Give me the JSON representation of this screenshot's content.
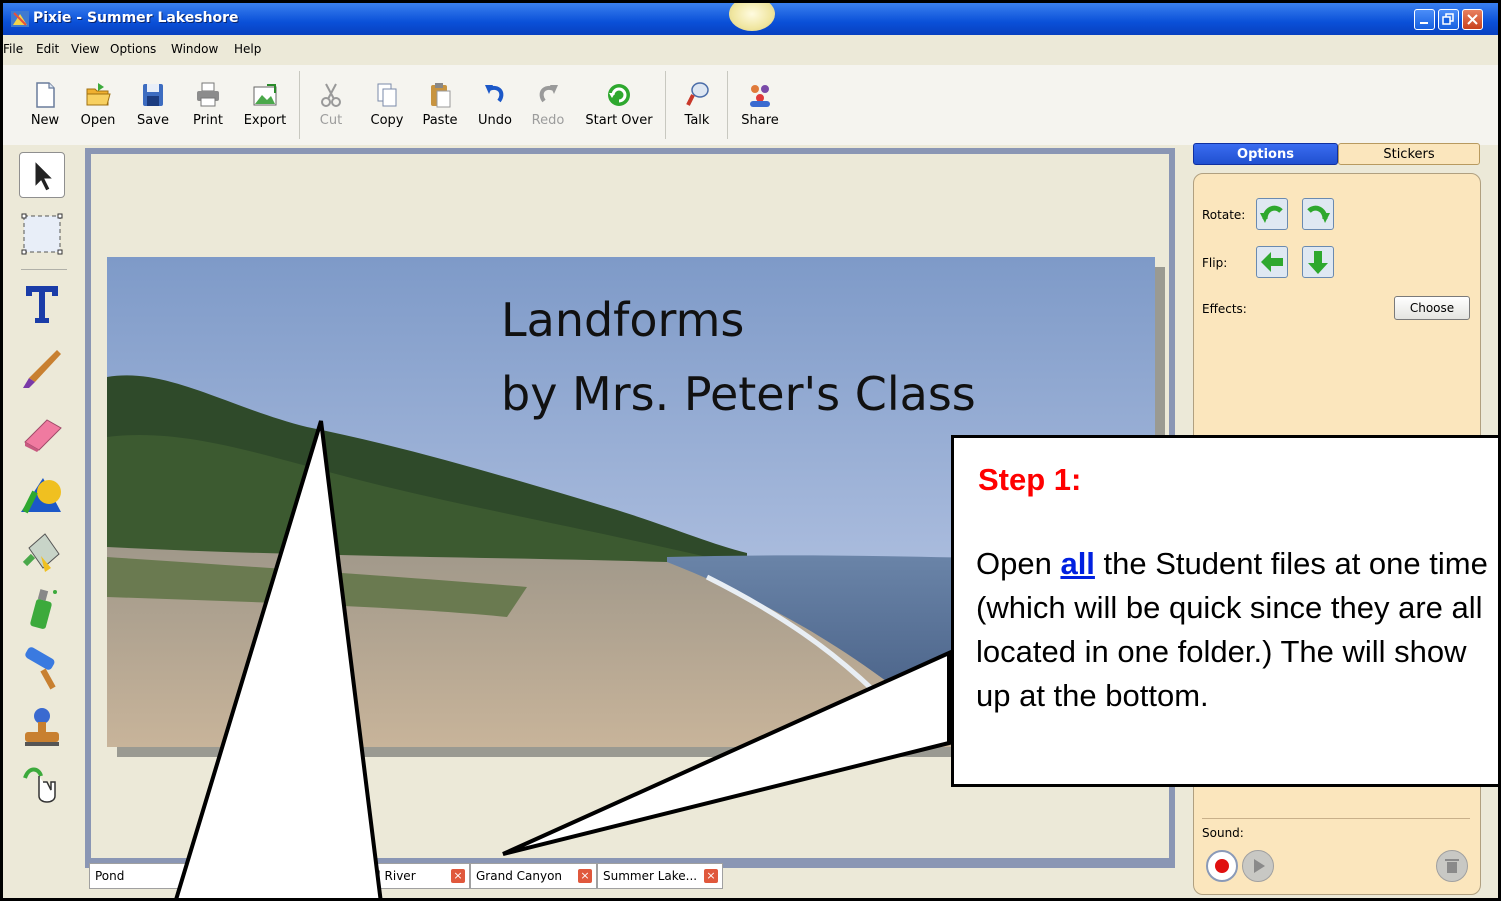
{
  "window": {
    "title": "Pixie - Summer Lakeshore"
  },
  "menu": [
    "File",
    "Edit",
    "View",
    "Options",
    "Window",
    "Help"
  ],
  "toolbar": {
    "new": "New",
    "open": "Open",
    "save": "Save",
    "print": "Print",
    "export": "Export",
    "cut": "Cut",
    "copy": "Copy",
    "paste": "Paste",
    "undo": "Undo",
    "redo": "Redo",
    "start_over": "Start Over",
    "talk": "Talk",
    "share": "Share"
  },
  "canvas": {
    "line1": "Landforms",
    "line2": "by Mrs. Peter's Class"
  },
  "tabs": [
    "Pond",
    "el River",
    "Grand Canyon",
    "Summer Lake..."
  ],
  "right_panel": {
    "tab_options": "Options",
    "tab_stickers": "Stickers",
    "rotate_label": "Rotate:",
    "flip_label": "Flip:",
    "effects_label": "Effects:",
    "choose_label": "Choose",
    "sound_label": "Sound:"
  },
  "callout": {
    "step_title": "Step 1:",
    "body_before": "Open ",
    "body_emphasis": "all",
    "body_after": " the Student files at one time (which will be quick since they are all located in one folder.)  The will show up at the bottom."
  },
  "colors": {
    "title_bar": "#0a50d8",
    "options_tab": "#2050d0",
    "panel_bg": "#fbe6bd",
    "step_title": "#ff0000",
    "emphasis": "#0020e0"
  }
}
